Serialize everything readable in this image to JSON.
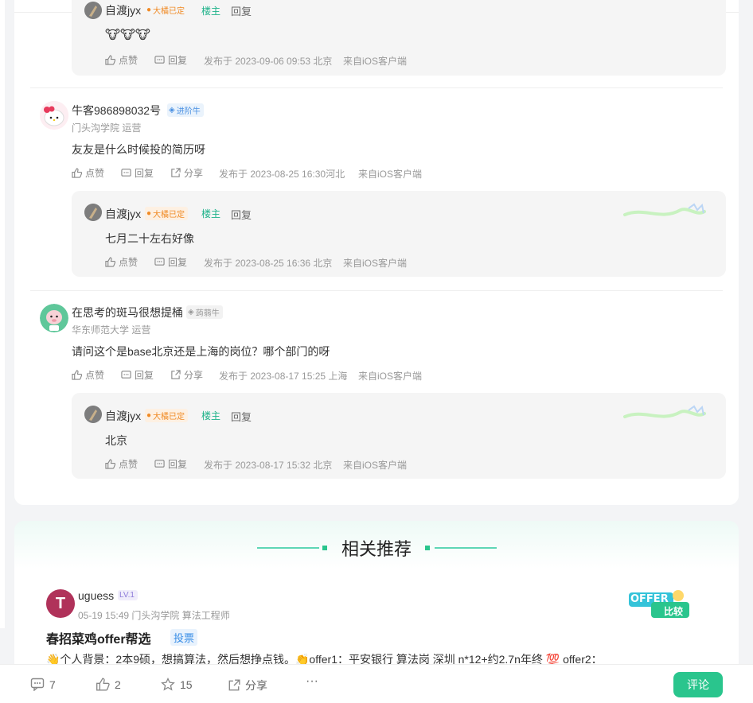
{
  "thread": {
    "reply0": {
      "user": "自渡jyx",
      "badge": "大橘已定",
      "owner": "楼主",
      "reply": "回复",
      "text": "🐮🐮🐮",
      "like": "点赞",
      "replyAct": "回复",
      "meta": "发布于 2023-09-06 09:53 北京",
      "src": "来自iOS客户端"
    },
    "comments": [
      {
        "user": "牛客986898032号",
        "level": "进阶牛",
        "school": "门头沟学院 运营",
        "text": "友友是什么时候投的简历呀",
        "like": "点赞",
        "reply": "回复",
        "share": "分享",
        "meta": "发布于 2023-08-25 16:30河北",
        "src": "来自iOS客户端",
        "sub": {
          "user": "自渡jyx",
          "badge": "大橘已定",
          "owner": "楼主",
          "reply": "回复",
          "text": "七月二十左右好像",
          "like": "点赞",
          "replyAct": "回复",
          "meta": "发布于 2023-08-25 16:36 北京",
          "src": "来自iOS客户端"
        }
      },
      {
        "user": "在思考的斑马很想提桶",
        "level": "蒟蒻牛",
        "school": "华东师范大学 运营",
        "text": "请问这个是base北京还是上海的岗位？哪个部门的呀",
        "like": "点赞",
        "reply": "回复",
        "share": "分享",
        "meta": "发布于 2023-08-17 15:25 上海",
        "src": "来自iOS客户端",
        "sub": {
          "user": "自渡jyx",
          "badge": "大橘已定",
          "owner": "楼主",
          "reply": "回复",
          "text": "北京",
          "like": "点赞",
          "replyAct": "回复",
          "meta": "发布于 2023-08-17 15:32 北京",
          "src": "来自iOS客户端"
        }
      }
    ]
  },
  "related": {
    "title": "相关推荐",
    "post": {
      "avatar_letter": "T",
      "user": "uguess",
      "level": "LV.1",
      "meta": "05-19 15:49  门头沟学院 算法工程师",
      "title": "春招菜鸡offer帮选",
      "tag": "投票",
      "excerpt": "👋个人背景：2本9硕，想搞算法，然后想挣点钱。👏offer1：平安银行 算法岗 深圳 n*12+约2.7n年终 💯 offer2：",
      "thumb_line1": "OFFER",
      "thumb_line2": "比较"
    }
  },
  "bottom_bar": {
    "comments": "7",
    "likes": "2",
    "stars": "15",
    "share": "分享",
    "more": "···",
    "comment_btn": "评论"
  },
  "colors": {
    "accent": "#2ac58d",
    "owner": "#1fb28a",
    "badge_orange": "#f08a24",
    "level_blue": "#4a90e2"
  }
}
